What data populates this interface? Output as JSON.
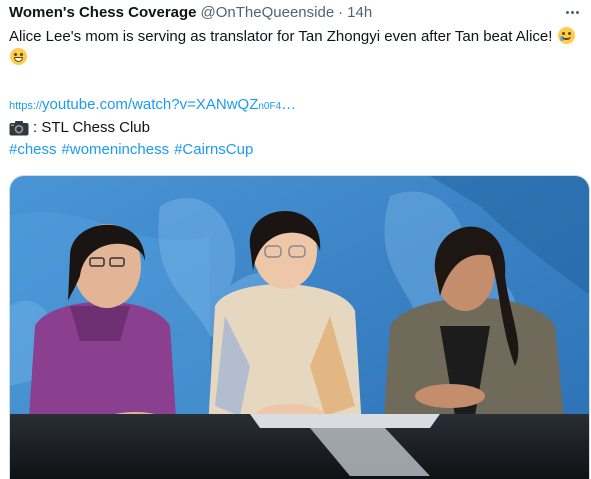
{
  "tweet": {
    "author_name": "Women's Chess Coverage",
    "handle": "@OnTheQueenside",
    "separator": "·",
    "time": "14h",
    "text": "Alice Lee's mom is serving as translator for Tan Zhongyi even after Tan beat Alice!",
    "emojis": [
      "crying-laughing-face",
      "grinning-squinting-face"
    ],
    "link": {
      "protocol": "https://",
      "main": "youtube.com/watch?v=XANwQZ",
      "tail": "n0F4",
      "ellipsis": "…"
    },
    "photo_credit_icon": "camera-icon",
    "photo_credit": ": STL Chess Club",
    "hashtags": [
      "#chess",
      "#womeninchess",
      "#CairnsCup"
    ]
  },
  "colors": {
    "link": "#1d9bf0",
    "text": "#0f1419",
    "muted": "#536471",
    "studio_bg": "#3a7fc4",
    "desk": "#1b1f23"
  }
}
